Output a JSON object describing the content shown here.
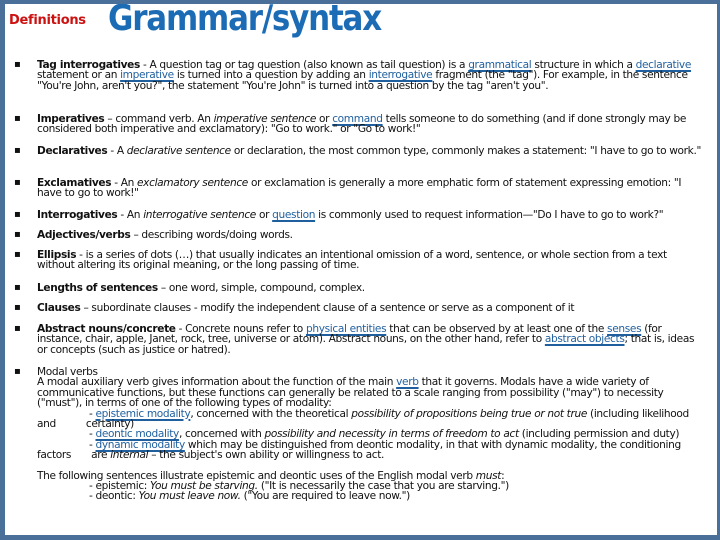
{
  "header": {
    "section_label": "Definitions",
    "title": "Grammar/syntax"
  },
  "theme": {
    "frame_color": "#4a6f98",
    "title_color": "#1b6cb5",
    "label_color": "#cc1111",
    "link_color": "#1f5f9e"
  },
  "items": {
    "tag": {
      "term": "Tag interrogatives",
      "t1": " - A question tag or tag question (also known as tail question) is a ",
      "l1": "grammatical",
      "t2": " structure in which a ",
      "l2": "declarative",
      "t3": " statement or an ",
      "l3": "imperative",
      "t4": " is turned into a question by adding an ",
      "l4": "interrogative",
      "t5": " fragment (the \"tag\"). For example, in the sentence \"You're John, aren't you?\", the statement \"You're John\" is turned into a question by the tag \"aren't you\"."
    },
    "imperatives": {
      "term": "Imperatives",
      "t1": " – command verb. An ",
      "i1": "imperative sentence",
      "t2": " or ",
      "l1": "command",
      "t3": " tells someone to do something (and if done strongly may be considered both imperative and exclamatory): \"Go to work.\" or \"Go to work!\""
    },
    "declaratives": {
      "term": "Declaratives",
      "t1": " - A ",
      "i1": "declarative sentence",
      "t2": " or declaration, the most common type, commonly makes a statement: \"I have to go to work.\""
    },
    "exclamatives": {
      "term": "Exclamatives",
      "t1": " - An ",
      "i1": "exclamatory sentence",
      "t2": " or exclamation is generally a more emphatic form of statement expressing emotion: \"I have to go to work!\""
    },
    "interrogatives": {
      "term": "Interrogatives",
      "t1": " - An ",
      "i1": "interrogative sentence",
      "t2": " or ",
      "l1": "question",
      "t3": " is commonly used to request information—\"Do I have to go to work?\""
    },
    "adjectives": {
      "term": "Adjectives/verbs",
      "t1": " – describing words/doing words."
    },
    "ellipsis": {
      "term": "Ellipsis",
      "t1": " - is a series of dots (…) that usually indicates an intentional omission of a word, sentence, or whole section from a text without altering its original meaning, or the long passing of time."
    },
    "lengths": {
      "term": "Lengths of sentences",
      "t1": " – one word, simple, compound, complex."
    },
    "clauses": {
      "term": "Clauses",
      "t1": " – subordinate clauses - modify the independent clause of a sentence or serve as a component of it"
    },
    "abstract": {
      "term": "Abstract nouns/concrete",
      "t1": " - Concrete nouns refer to ",
      "l1": "physical entities",
      "t2": " that can be observed by at least one of the ",
      "l2": "senses",
      "t3": " (for instance, chair, apple, Janet, rock, tree, universe or atom). Abstract nouns, on the other hand, refer to ",
      "l3": "abstract objects",
      "t4": "; that is, ideas or concepts (such as justice or hatred)."
    },
    "modal": {
      "term": "Modal verbs",
      "p1": "A modal auxiliary verb gives information about the function of the main ",
      "l_verb": "verb",
      "p2": " that it governs. Modals have a wide variety of communicative functions, but these functions can generally be related to a scale ranging from possibility (\"may\") to necessity (\"must\"), in terms of one of the following types of modality:",
      "dash": "- ",
      "l_epistemic": "epistemic modality",
      "e1": ", concerned with the theoretical ",
      "e_it": "possibility of propositions being true or not true",
      "e2": " (including likelihood and",
      "e3": "certainty)",
      "l_deontic": "deontic modality",
      "d1": ", concerned with ",
      "d_it": "possibility and necessity in terms of freedom to act",
      "d2": " (including permission and duty)",
      "l_dynamic": "dynamic modality",
      "y1": " which may be distinguished from deontic modality, in that with dynamic modality, the conditioning factors",
      "y2": "are ",
      "y_it": "internal",
      "y3": " – the subject's own ability or willingness to act.",
      "ex_intro": "The following sentences illustrate epistemic and deontic uses of the English modal verb ",
      "ex_must": "must",
      "ex_colon": ":",
      "ex1_label": "- epistemic: ",
      "ex1_it": "You must be starving.",
      "ex1_rest": " (\"It is necessarily the case that you are starving.\")",
      "ex2_label": "- deontic: ",
      "ex2_it": "You must leave now.",
      "ex2_rest": " (\"You are required to leave now.\")"
    }
  }
}
